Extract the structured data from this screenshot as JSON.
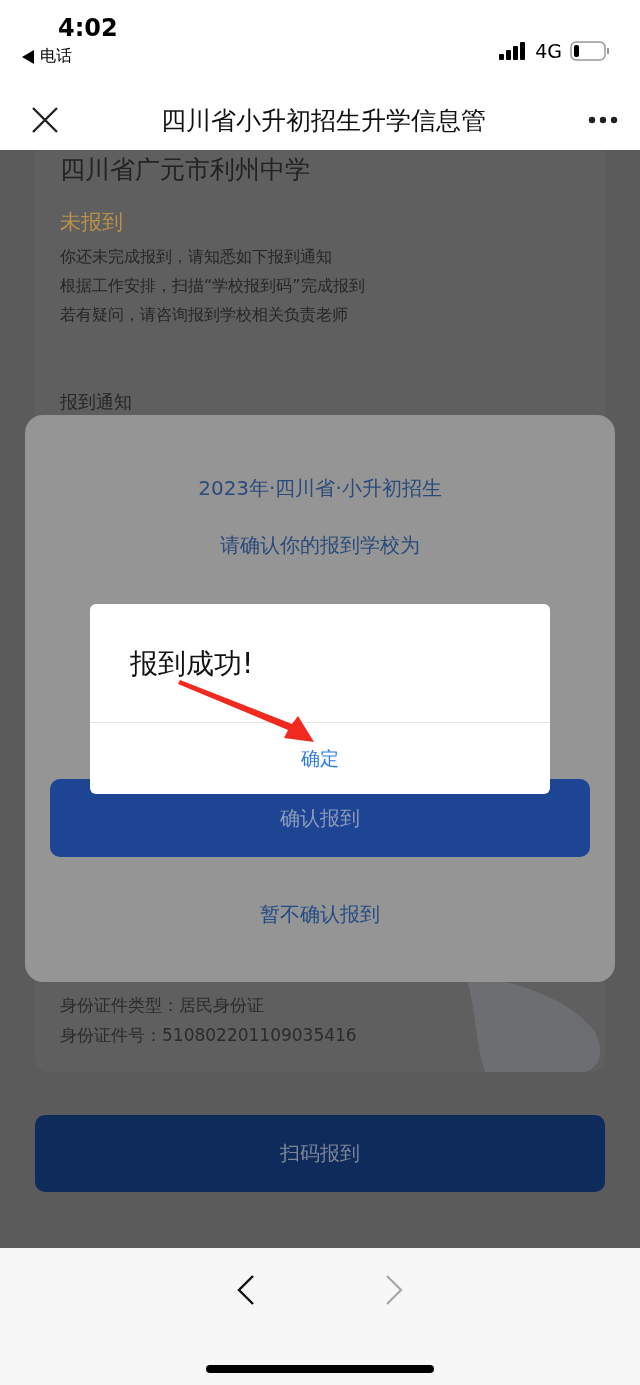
{
  "status_bar": {
    "time": "4:02",
    "back_app": "电话",
    "network": "4G"
  },
  "nav_bar": {
    "title": "四川省小升初招生升学信息管"
  },
  "page": {
    "school": "四川省广元市利州中学",
    "status": "未报到",
    "notices": [
      "你还未完成报到，请知悉如下报到通知",
      "根据工作安排，扫描“学校报到码”完成报到",
      "若有疑问，请咨询报到学校相关负责老师"
    ],
    "section_title": "报到通知",
    "id_lines": [
      "身份证件类型：居民身份证",
      "身份证件号：510802201109035416"
    ],
    "scan_button": "扫码报到"
  },
  "confirm_dialog": {
    "title": "2023年·四川省·小升初招生",
    "subtitle": "请确认你的报到学校为",
    "confirm_button": "确认报到",
    "cancel_button": "暂不确认报到"
  },
  "alert": {
    "message": "报到成功!",
    "ok_button": "确定"
  },
  "toolbar": {
    "back_disabled": false,
    "forward_disabled": true
  }
}
